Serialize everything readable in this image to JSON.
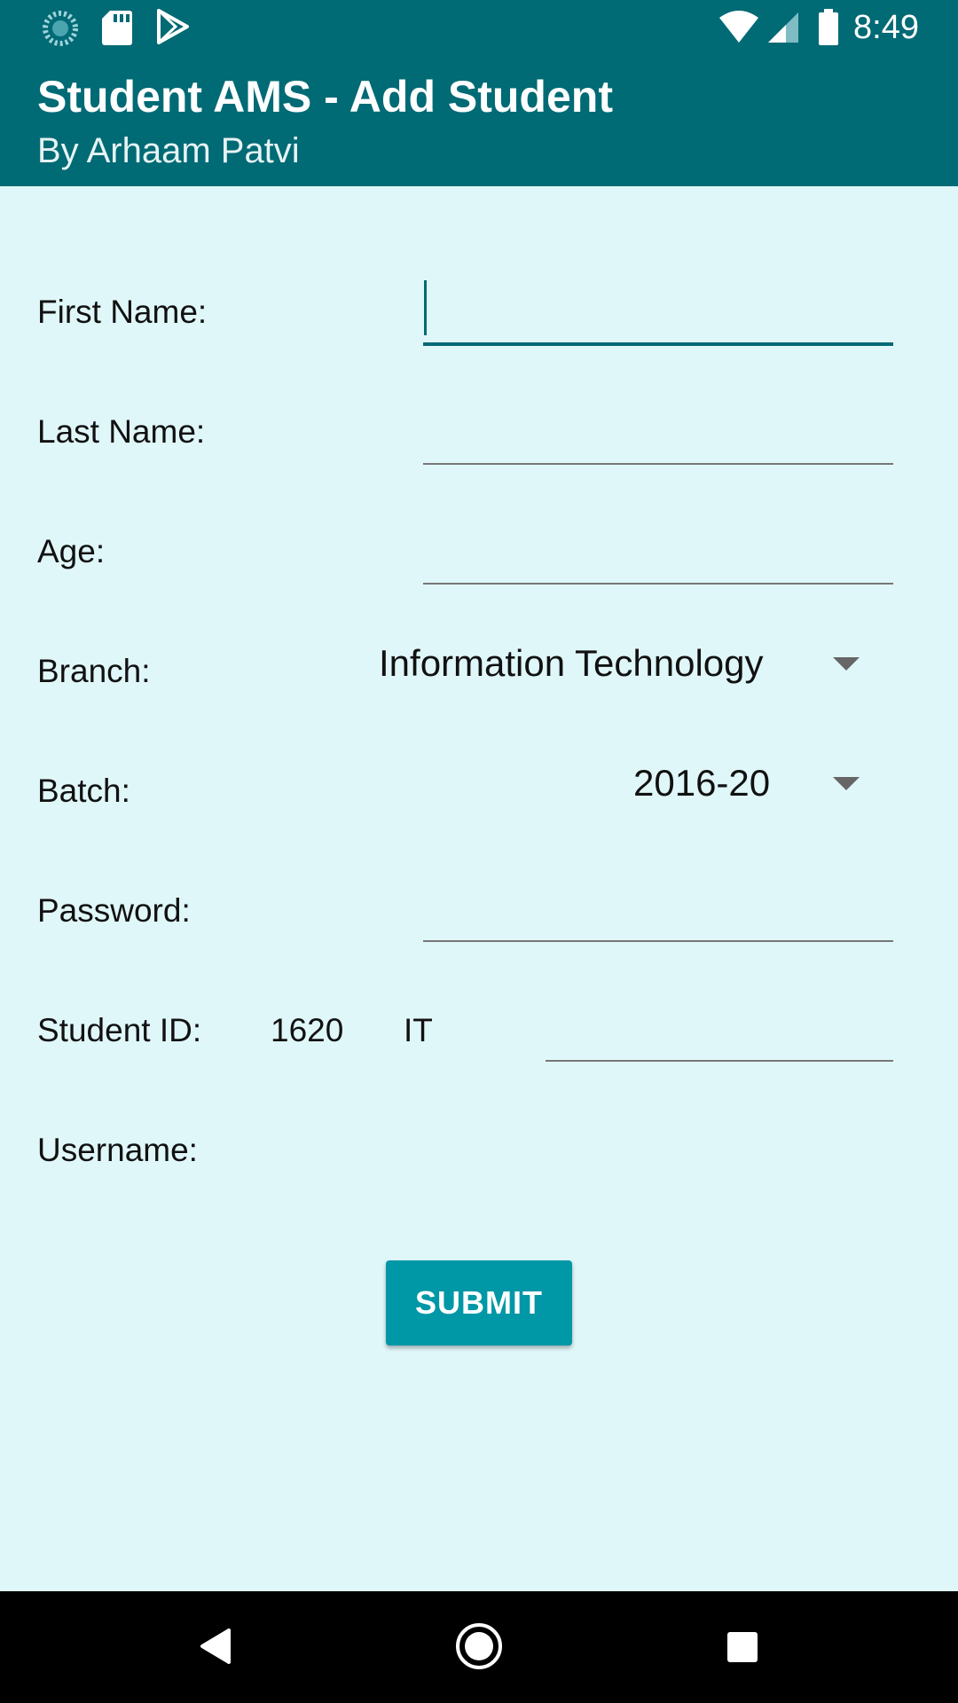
{
  "status_bar": {
    "time": "8:49",
    "left_icons": [
      "sync-icon",
      "sd-card-icon",
      "play-store-icon"
    ],
    "right_icons": [
      "wifi-icon",
      "cell-signal-icon",
      "battery-icon"
    ]
  },
  "app_bar": {
    "title": "Student AMS - Add Student",
    "subtitle": "By Arhaam Patvi",
    "color": "#006a75"
  },
  "form": {
    "first_name": {
      "label": "First Name:",
      "value": ""
    },
    "last_name": {
      "label": "Last Name:",
      "value": ""
    },
    "age": {
      "label": "Age:",
      "value": ""
    },
    "branch": {
      "label": "Branch:",
      "selected": "Information Technology"
    },
    "batch": {
      "label": "Batch:",
      "selected": "2016-20"
    },
    "password": {
      "label": "Password:",
      "value": ""
    },
    "student_id": {
      "label": "Student ID:",
      "prefix_year": "1620",
      "prefix_branch": "IT",
      "value": ""
    },
    "username": {
      "label": "Username:",
      "value": ""
    },
    "submit_label": "SUBMIT"
  },
  "colors": {
    "background": "#e0f7f9",
    "accent": "#0097a7",
    "primary_dark": "#006a75"
  },
  "nav_bar": {
    "icons": [
      "back-icon",
      "home-icon",
      "recents-icon"
    ]
  }
}
